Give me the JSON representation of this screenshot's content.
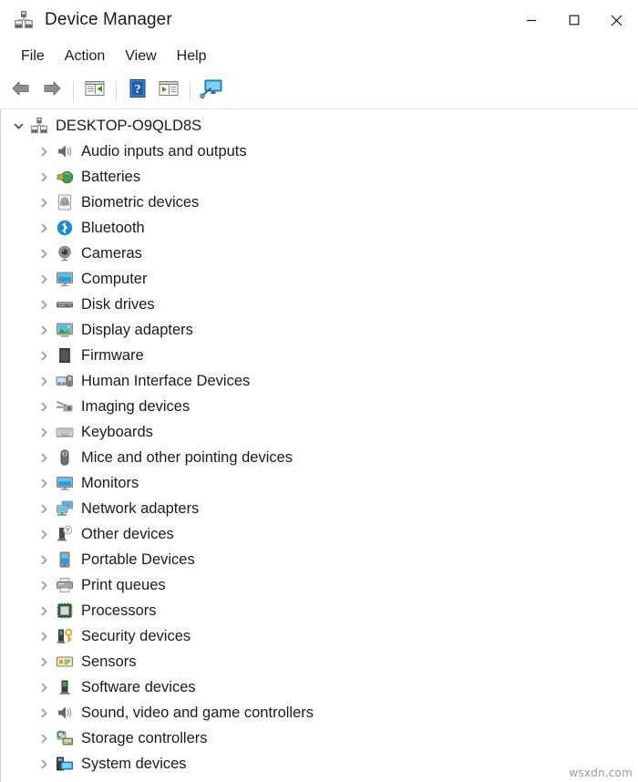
{
  "window": {
    "title": "Device Manager",
    "icon": "device-manager-icon",
    "controls": {
      "minimize": "minimize-icon",
      "maximize": "maximize-icon",
      "close": "close-icon"
    }
  },
  "menu": {
    "items": [
      {
        "label": "File",
        "name": "menu-file"
      },
      {
        "label": "Action",
        "name": "menu-action"
      },
      {
        "label": "View",
        "name": "menu-view"
      },
      {
        "label": "Help",
        "name": "menu-help"
      }
    ]
  },
  "toolbar": {
    "buttons": [
      {
        "name": "back-button",
        "icon": "back-arrow-icon",
        "tooltip": "Back"
      },
      {
        "name": "forward-button",
        "icon": "forward-arrow-icon",
        "tooltip": "Forward"
      },
      {
        "name": "show-hide-console-tree-button",
        "icon": "console-tree-icon",
        "tooltip": "Show/Hide Console Tree"
      },
      {
        "name": "help-button",
        "icon": "help-question-icon",
        "tooltip": "Help"
      },
      {
        "name": "properties-button",
        "icon": "properties-icon",
        "tooltip": "Properties"
      },
      {
        "name": "scan-hardware-changes-button",
        "icon": "scan-monitor-icon",
        "tooltip": "Scan for hardware changes"
      }
    ]
  },
  "tree": {
    "root": {
      "label": "DESKTOP-O9QLD8S",
      "icon": "computer-node-icon",
      "expanded": true
    },
    "nodes": [
      {
        "label": "Audio inputs and outputs",
        "icon": "speaker-icon"
      },
      {
        "label": "Batteries",
        "icon": "battery-plug-icon"
      },
      {
        "label": "Biometric devices",
        "icon": "fingerprint-icon"
      },
      {
        "label": "Bluetooth",
        "icon": "bluetooth-icon"
      },
      {
        "label": "Cameras",
        "icon": "camera-icon"
      },
      {
        "label": "Computer",
        "icon": "computer-icon"
      },
      {
        "label": "Disk drives",
        "icon": "disk-drive-icon"
      },
      {
        "label": "Display adapters",
        "icon": "display-adapter-icon"
      },
      {
        "label": "Firmware",
        "icon": "firmware-chip-icon"
      },
      {
        "label": "Human Interface Devices",
        "icon": "hid-icon"
      },
      {
        "label": "Imaging devices",
        "icon": "imaging-scanner-icon"
      },
      {
        "label": "Keyboards",
        "icon": "keyboard-icon"
      },
      {
        "label": "Mice and other pointing devices",
        "icon": "mouse-icon"
      },
      {
        "label": "Monitors",
        "icon": "monitor-icon"
      },
      {
        "label": "Network adapters",
        "icon": "network-adapter-icon"
      },
      {
        "label": "Other devices",
        "icon": "other-device-question-icon"
      },
      {
        "label": "Portable Devices",
        "icon": "portable-device-icon"
      },
      {
        "label": "Print queues",
        "icon": "printer-icon"
      },
      {
        "label": "Processors",
        "icon": "processor-chip-icon"
      },
      {
        "label": "Security devices",
        "icon": "security-key-icon"
      },
      {
        "label": "Sensors",
        "icon": "sensor-icon"
      },
      {
        "label": "Software devices",
        "icon": "software-device-icon"
      },
      {
        "label": "Sound, video and game controllers",
        "icon": "sound-speaker-icon"
      },
      {
        "label": "Storage controllers",
        "icon": "storage-controller-icon"
      },
      {
        "label": "System devices",
        "icon": "system-device-icon"
      }
    ]
  },
  "watermark": {
    "text": "wsxdn.com"
  },
  "colors": {
    "window_bg": "#ffffff",
    "text": "#1b1b1b",
    "chevron": "#6d6d6d",
    "accent_blue": "#0078d7",
    "bluetooth": "#1f8ad2",
    "border": "#cfcfcf"
  }
}
